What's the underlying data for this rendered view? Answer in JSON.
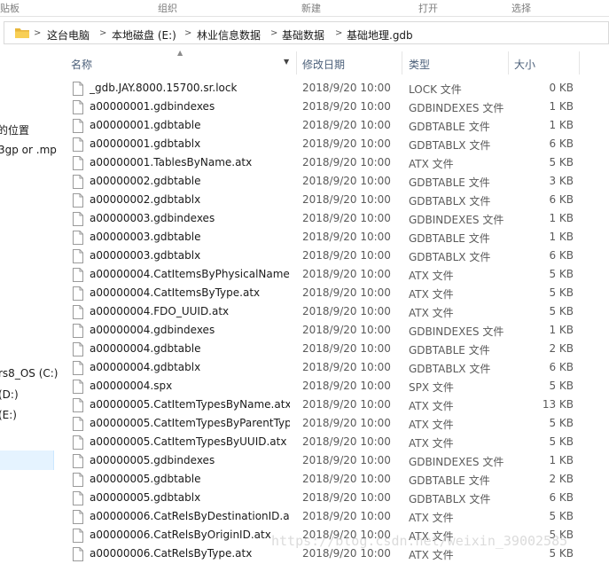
{
  "ribbon": {
    "groups": [
      "贴板",
      "组织",
      "新建",
      "打开",
      "选择"
    ]
  },
  "address_bar": {
    "crumbs": [
      "这台电脑",
      "本地磁盘 (E:)",
      "林业信息数据",
      "基础数据",
      "基础地理.gdb"
    ]
  },
  "nav_pane": {
    "items": [
      "的位置",
      "3gp or .mp",
      "rs8_OS (C:)",
      "(D:)",
      "(E:)"
    ]
  },
  "columns": {
    "name": "名称",
    "date": "修改日期",
    "type": "类型",
    "size": "大小"
  },
  "files": [
    {
      "name": "_gdb.JAY.8000.15700.sr.lock",
      "date": "2018/9/20 10:00",
      "type": "LOCK 文件",
      "size": "0 KB"
    },
    {
      "name": "a00000001.gdbindexes",
      "date": "2018/9/20 10:00",
      "type": "GDBINDEXES 文件",
      "size": "1 KB"
    },
    {
      "name": "a00000001.gdbtable",
      "date": "2018/9/20 10:00",
      "type": "GDBTABLE 文件",
      "size": "1 KB"
    },
    {
      "name": "a00000001.gdbtablx",
      "date": "2018/9/20 10:00",
      "type": "GDBTABLX 文件",
      "size": "6 KB"
    },
    {
      "name": "a00000001.TablesByName.atx",
      "date": "2018/9/20 10:00",
      "type": "ATX 文件",
      "size": "5 KB"
    },
    {
      "name": "a00000002.gdbtable",
      "date": "2018/9/20 10:00",
      "type": "GDBTABLE 文件",
      "size": "3 KB"
    },
    {
      "name": "a00000002.gdbtablx",
      "date": "2018/9/20 10:00",
      "type": "GDBTABLX 文件",
      "size": "6 KB"
    },
    {
      "name": "a00000003.gdbindexes",
      "date": "2018/9/20 10:00",
      "type": "GDBINDEXES 文件",
      "size": "1 KB"
    },
    {
      "name": "a00000003.gdbtable",
      "date": "2018/9/20 10:00",
      "type": "GDBTABLE 文件",
      "size": "1 KB"
    },
    {
      "name": "a00000003.gdbtablx",
      "date": "2018/9/20 10:00",
      "type": "GDBTABLX 文件",
      "size": "6 KB"
    },
    {
      "name": "a00000004.CatItemsByPhysicalName....",
      "date": "2018/9/20 10:00",
      "type": "ATX 文件",
      "size": "5 KB"
    },
    {
      "name": "a00000004.CatItemsByType.atx",
      "date": "2018/9/20 10:00",
      "type": "ATX 文件",
      "size": "5 KB"
    },
    {
      "name": "a00000004.FDO_UUID.atx",
      "date": "2018/9/20 10:00",
      "type": "ATX 文件",
      "size": "5 KB"
    },
    {
      "name": "a00000004.gdbindexes",
      "date": "2018/9/20 10:00",
      "type": "GDBINDEXES 文件",
      "size": "1 KB"
    },
    {
      "name": "a00000004.gdbtable",
      "date": "2018/9/20 10:00",
      "type": "GDBTABLE 文件",
      "size": "2 KB"
    },
    {
      "name": "a00000004.gdbtablx",
      "date": "2018/9/20 10:00",
      "type": "GDBTABLX 文件",
      "size": "6 KB"
    },
    {
      "name": "a00000004.spx",
      "date": "2018/9/20 10:00",
      "type": "SPX 文件",
      "size": "5 KB"
    },
    {
      "name": "a00000005.CatItemTypesByName.atx",
      "date": "2018/9/20 10:00",
      "type": "ATX 文件",
      "size": "13 KB"
    },
    {
      "name": "a00000005.CatItemTypesByParentTyp...",
      "date": "2018/9/20 10:00",
      "type": "ATX 文件",
      "size": "5 KB"
    },
    {
      "name": "a00000005.CatItemTypesByUUID.atx",
      "date": "2018/9/20 10:00",
      "type": "ATX 文件",
      "size": "5 KB"
    },
    {
      "name": "a00000005.gdbindexes",
      "date": "2018/9/20 10:00",
      "type": "GDBINDEXES 文件",
      "size": "1 KB"
    },
    {
      "name": "a00000005.gdbtable",
      "date": "2018/9/20 10:00",
      "type": "GDBTABLE 文件",
      "size": "2 KB"
    },
    {
      "name": "a00000005.gdbtablx",
      "date": "2018/9/20 10:00",
      "type": "GDBTABLX 文件",
      "size": "6 KB"
    },
    {
      "name": "a00000006.CatRelsByDestinationID.atx",
      "date": "2018/9/20 10:00",
      "type": "ATX 文件",
      "size": "5 KB"
    },
    {
      "name": "a00000006.CatRelsByOriginID.atx",
      "date": "2018/9/20 10:00",
      "type": "ATX 文件",
      "size": "5 KB"
    },
    {
      "name": "a00000006.CatRelsByType.atx",
      "date": "2018/9/20 10:00",
      "type": "ATX 文件",
      "size": "5 KB"
    }
  ],
  "watermark": "https://blog.csdn.net/weixin_39002585",
  "colors": {
    "header_text": "#4c607a",
    "detail_text": "#5a5a5a",
    "selection": "#e5f3ff",
    "folder": "#f5c342"
  }
}
